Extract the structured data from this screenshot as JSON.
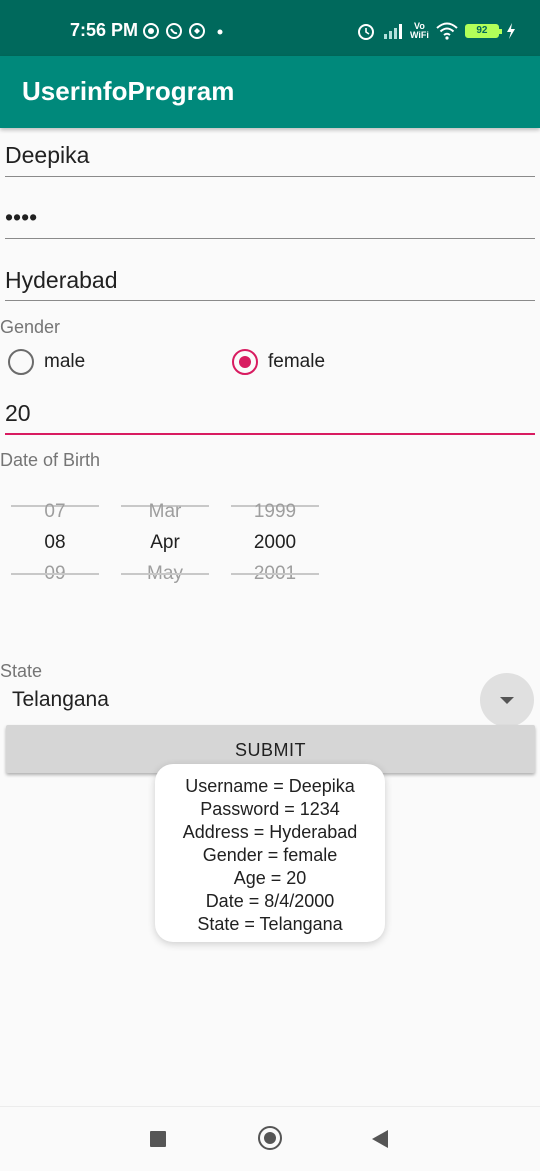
{
  "status_bar": {
    "time": "7:56 PM",
    "vowifi_top": "Vo",
    "vowifi_bottom": "WiFi",
    "battery": "92",
    "icons": [
      "camera-icon",
      "whatsapp-icon",
      "vpn-icon",
      "notification-dot-icon",
      "alarm-icon",
      "signal-icon",
      "vowifi-icon",
      "wifi-icon",
      "battery-icon",
      "charging-icon"
    ]
  },
  "app_bar": {
    "title": "UserinfoProgram"
  },
  "form": {
    "username": "Deepika",
    "password": "••••",
    "address": "Hyderabad",
    "gender_label": "Gender",
    "gender_options": [
      {
        "label": "male",
        "checked": false
      },
      {
        "label": "female",
        "checked": true
      }
    ],
    "age": "20",
    "dob_label": "Date of Birth",
    "date_picker": {
      "day": {
        "prev": "07",
        "current": "08",
        "next": "09"
      },
      "month": {
        "prev": "Mar",
        "current": "Apr",
        "next": "May"
      },
      "year": {
        "prev": "1999",
        "current": "2000",
        "next": "2001"
      }
    },
    "state_label": "State",
    "state_value": "Telangana",
    "submit_label": "SUBMIT"
  },
  "toast": {
    "lines": [
      "Username = Deepika",
      "Password = 1234",
      "Address = Hyderabad",
      "Gender = female",
      "Age = 20",
      "Date = 8/4/2000",
      "State = Telangana"
    ]
  },
  "colors": {
    "status_bar": "#00695c",
    "app_bar": "#00897b",
    "accent": "#d81b60",
    "battery": "#b2ff59"
  }
}
